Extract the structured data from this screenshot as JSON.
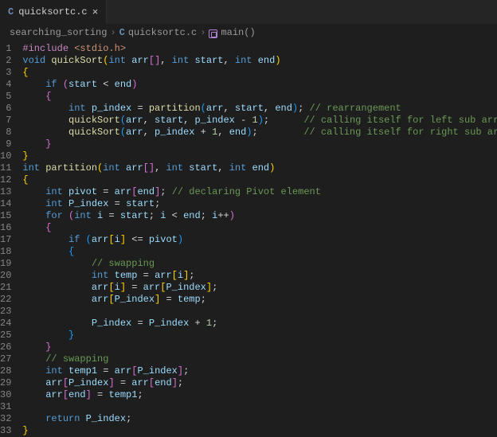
{
  "tab": {
    "icon_label": "C",
    "title": "quicksortc.c",
    "close_glyph": "×"
  },
  "breadcrumbs": {
    "seg1": "searching_sorting",
    "sep": "›",
    "file_icon": "C",
    "seg2": "quicksortc.c",
    "seg3": "main()"
  },
  "code": {
    "lines": [
      {
        "n": "1",
        "tokens": [
          [
            "pp",
            "#include"
          ],
          [
            "op",
            " "
          ],
          [
            "str",
            "<stdio.h>"
          ]
        ]
      },
      {
        "n": "2",
        "tokens": [
          [
            "ty",
            "void"
          ],
          [
            "op",
            " "
          ],
          [
            "fn",
            "quickSort"
          ],
          [
            "br1",
            "("
          ],
          [
            "ty",
            "int"
          ],
          [
            "op",
            " "
          ],
          [
            "id",
            "arr"
          ],
          [
            "br2",
            "["
          ],
          [
            "br2",
            "]"
          ],
          [
            "pn",
            ", "
          ],
          [
            "ty",
            "int"
          ],
          [
            "op",
            " "
          ],
          [
            "id",
            "start"
          ],
          [
            "pn",
            ", "
          ],
          [
            "ty",
            "int"
          ],
          [
            "op",
            " "
          ],
          [
            "id",
            "end"
          ],
          [
            "br1",
            ")"
          ]
        ]
      },
      {
        "n": "3",
        "tokens": [
          [
            "br1",
            "{"
          ]
        ]
      },
      {
        "n": "4",
        "tokens": [
          [
            "op",
            "    "
          ],
          [
            "kw",
            "if"
          ],
          [
            "op",
            " "
          ],
          [
            "br2",
            "("
          ],
          [
            "id",
            "start"
          ],
          [
            "op",
            " < "
          ],
          [
            "id",
            "end"
          ],
          [
            "br2",
            ")"
          ]
        ]
      },
      {
        "n": "5",
        "tokens": [
          [
            "op",
            "    "
          ],
          [
            "br2",
            "{"
          ]
        ]
      },
      {
        "n": "6",
        "tokens": [
          [
            "op",
            "        "
          ],
          [
            "ty",
            "int"
          ],
          [
            "op",
            " "
          ],
          [
            "id",
            "p_index"
          ],
          [
            "op",
            " = "
          ],
          [
            "fn",
            "partition"
          ],
          [
            "br3",
            "("
          ],
          [
            "id",
            "arr"
          ],
          [
            "pn",
            ", "
          ],
          [
            "id",
            "start"
          ],
          [
            "pn",
            ", "
          ],
          [
            "id",
            "end"
          ],
          [
            "br3",
            ")"
          ],
          [
            "pn",
            "; "
          ],
          [
            "cm",
            "// rearrangement"
          ]
        ]
      },
      {
        "n": "7",
        "tokens": [
          [
            "op",
            "        "
          ],
          [
            "fn",
            "quickSort"
          ],
          [
            "br3",
            "("
          ],
          [
            "id",
            "arr"
          ],
          [
            "pn",
            ", "
          ],
          [
            "id",
            "start"
          ],
          [
            "pn",
            ", "
          ],
          [
            "id",
            "p_index"
          ],
          [
            "op",
            " - "
          ],
          [
            "num",
            "1"
          ],
          [
            "br3",
            ")"
          ],
          [
            "pn",
            ";      "
          ],
          [
            "cm",
            "// calling itself for left sub array"
          ]
        ]
      },
      {
        "n": "8",
        "tokens": [
          [
            "op",
            "        "
          ],
          [
            "fn",
            "quickSort"
          ],
          [
            "br3",
            "("
          ],
          [
            "id",
            "arr"
          ],
          [
            "pn",
            ", "
          ],
          [
            "id",
            "p_index"
          ],
          [
            "op",
            " + "
          ],
          [
            "num",
            "1"
          ],
          [
            "pn",
            ", "
          ],
          [
            "id",
            "end"
          ],
          [
            "br3",
            ")"
          ],
          [
            "pn",
            ";        "
          ],
          [
            "cm",
            "// calling itself for right sub array"
          ]
        ]
      },
      {
        "n": "9",
        "tokens": [
          [
            "op",
            "    "
          ],
          [
            "br2",
            "}"
          ]
        ]
      },
      {
        "n": "10",
        "tokens": [
          [
            "br1",
            "}"
          ]
        ]
      },
      {
        "n": "11",
        "tokens": [
          [
            "ty",
            "int"
          ],
          [
            "op",
            " "
          ],
          [
            "fn",
            "partition"
          ],
          [
            "br1",
            "("
          ],
          [
            "ty",
            "int"
          ],
          [
            "op",
            " "
          ],
          [
            "id",
            "arr"
          ],
          [
            "br2",
            "["
          ],
          [
            "br2",
            "]"
          ],
          [
            "pn",
            ", "
          ],
          [
            "ty",
            "int"
          ],
          [
            "op",
            " "
          ],
          [
            "id",
            "start"
          ],
          [
            "pn",
            ", "
          ],
          [
            "ty",
            "int"
          ],
          [
            "op",
            " "
          ],
          [
            "id",
            "end"
          ],
          [
            "br1",
            ")"
          ]
        ]
      },
      {
        "n": "12",
        "tokens": [
          [
            "br1",
            "{"
          ]
        ]
      },
      {
        "n": "13",
        "tokens": [
          [
            "op",
            "    "
          ],
          [
            "ty",
            "int"
          ],
          [
            "op",
            " "
          ],
          [
            "id",
            "pivot"
          ],
          [
            "op",
            " = "
          ],
          [
            "id",
            "arr"
          ],
          [
            "br2",
            "["
          ],
          [
            "id",
            "end"
          ],
          [
            "br2",
            "]"
          ],
          [
            "pn",
            "; "
          ],
          [
            "cm",
            "// declaring Pivot element"
          ]
        ]
      },
      {
        "n": "14",
        "tokens": [
          [
            "op",
            "    "
          ],
          [
            "ty",
            "int"
          ],
          [
            "op",
            " "
          ],
          [
            "id",
            "P_index"
          ],
          [
            "op",
            " = "
          ],
          [
            "id",
            "start"
          ],
          [
            "pn",
            ";"
          ]
        ]
      },
      {
        "n": "15",
        "tokens": [
          [
            "op",
            "    "
          ],
          [
            "kw",
            "for"
          ],
          [
            "op",
            " "
          ],
          [
            "br2",
            "("
          ],
          [
            "ty",
            "int"
          ],
          [
            "op",
            " "
          ],
          [
            "id",
            "i"
          ],
          [
            "op",
            " = "
          ],
          [
            "id",
            "start"
          ],
          [
            "pn",
            "; "
          ],
          [
            "id",
            "i"
          ],
          [
            "op",
            " < "
          ],
          [
            "id",
            "end"
          ],
          [
            "pn",
            "; "
          ],
          [
            "id",
            "i"
          ],
          [
            "op",
            "++"
          ],
          [
            "br2",
            ")"
          ]
        ]
      },
      {
        "n": "16",
        "tokens": [
          [
            "op",
            "    "
          ],
          [
            "br2",
            "{"
          ]
        ]
      },
      {
        "n": "17",
        "tokens": [
          [
            "op",
            "        "
          ],
          [
            "kw",
            "if"
          ],
          [
            "op",
            " "
          ],
          [
            "br3",
            "("
          ],
          [
            "id",
            "arr"
          ],
          [
            "br1",
            "["
          ],
          [
            "id",
            "i"
          ],
          [
            "br1",
            "]"
          ],
          [
            "op",
            " <= "
          ],
          [
            "id",
            "pivot"
          ],
          [
            "br3",
            ")"
          ]
        ]
      },
      {
        "n": "18",
        "tokens": [
          [
            "op",
            "        "
          ],
          [
            "br3",
            "{"
          ]
        ]
      },
      {
        "n": "19",
        "tokens": [
          [
            "op",
            "            "
          ],
          [
            "cm",
            "// swapping"
          ]
        ]
      },
      {
        "n": "20",
        "tokens": [
          [
            "op",
            "            "
          ],
          [
            "ty",
            "int"
          ],
          [
            "op",
            " "
          ],
          [
            "id",
            "temp"
          ],
          [
            "op",
            " = "
          ],
          [
            "id",
            "arr"
          ],
          [
            "br1",
            "["
          ],
          [
            "id",
            "i"
          ],
          [
            "br1",
            "]"
          ],
          [
            "pn",
            ";"
          ]
        ]
      },
      {
        "n": "21",
        "tokens": [
          [
            "op",
            "            "
          ],
          [
            "id",
            "arr"
          ],
          [
            "br1",
            "["
          ],
          [
            "id",
            "i"
          ],
          [
            "br1",
            "]"
          ],
          [
            "op",
            " = "
          ],
          [
            "id",
            "arr"
          ],
          [
            "br1",
            "["
          ],
          [
            "id",
            "P_index"
          ],
          [
            "br1",
            "]"
          ],
          [
            "pn",
            ";"
          ]
        ]
      },
      {
        "n": "22",
        "tokens": [
          [
            "op",
            "            "
          ],
          [
            "id",
            "arr"
          ],
          [
            "br1",
            "["
          ],
          [
            "id",
            "P_index"
          ],
          [
            "br1",
            "]"
          ],
          [
            "op",
            " = "
          ],
          [
            "id",
            "temp"
          ],
          [
            "pn",
            ";"
          ]
        ]
      },
      {
        "n": "23",
        "tokens": []
      },
      {
        "n": "24",
        "tokens": [
          [
            "op",
            "            "
          ],
          [
            "id",
            "P_index"
          ],
          [
            "op",
            " = "
          ],
          [
            "id",
            "P_index"
          ],
          [
            "op",
            " + "
          ],
          [
            "num",
            "1"
          ],
          [
            "pn",
            ";"
          ]
        ]
      },
      {
        "n": "25",
        "tokens": [
          [
            "op",
            "        "
          ],
          [
            "br3",
            "}"
          ]
        ]
      },
      {
        "n": "26",
        "tokens": [
          [
            "op",
            "    "
          ],
          [
            "br2",
            "}"
          ]
        ]
      },
      {
        "n": "27",
        "tokens": [
          [
            "op",
            "    "
          ],
          [
            "cm",
            "// swapping"
          ]
        ]
      },
      {
        "n": "28",
        "tokens": [
          [
            "op",
            "    "
          ],
          [
            "ty",
            "int"
          ],
          [
            "op",
            " "
          ],
          [
            "id",
            "temp1"
          ],
          [
            "op",
            " = "
          ],
          [
            "id",
            "arr"
          ],
          [
            "br2",
            "["
          ],
          [
            "id",
            "P_index"
          ],
          [
            "br2",
            "]"
          ],
          [
            "pn",
            ";"
          ]
        ]
      },
      {
        "n": "29",
        "tokens": [
          [
            "op",
            "    "
          ],
          [
            "id",
            "arr"
          ],
          [
            "br2",
            "["
          ],
          [
            "id",
            "P_index"
          ],
          [
            "br2",
            "]"
          ],
          [
            "op",
            " = "
          ],
          [
            "id",
            "arr"
          ],
          [
            "br2",
            "["
          ],
          [
            "id",
            "end"
          ],
          [
            "br2",
            "]"
          ],
          [
            "pn",
            ";"
          ]
        ]
      },
      {
        "n": "30",
        "tokens": [
          [
            "op",
            "    "
          ],
          [
            "id",
            "arr"
          ],
          [
            "br2",
            "["
          ],
          [
            "id",
            "end"
          ],
          [
            "br2",
            "]"
          ],
          [
            "op",
            " = "
          ],
          [
            "id",
            "temp1"
          ],
          [
            "pn",
            ";"
          ]
        ]
      },
      {
        "n": "31",
        "tokens": []
      },
      {
        "n": "32",
        "tokens": [
          [
            "op",
            "    "
          ],
          [
            "kw",
            "return"
          ],
          [
            "op",
            " "
          ],
          [
            "id",
            "P_index"
          ],
          [
            "pn",
            ";"
          ]
        ]
      },
      {
        "n": "33",
        "tokens": [
          [
            "br1",
            "}"
          ]
        ]
      }
    ]
  }
}
